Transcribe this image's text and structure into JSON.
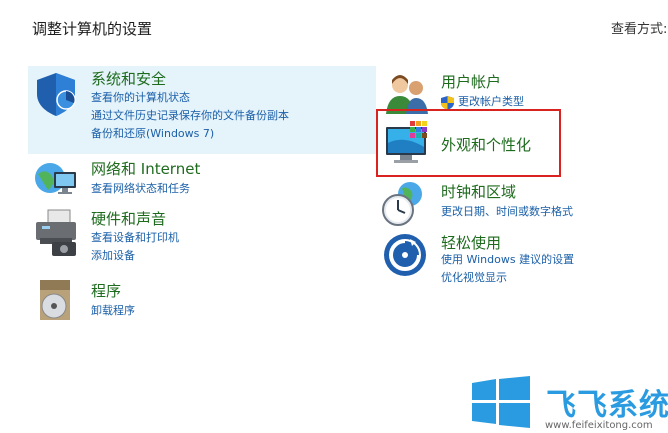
{
  "header": {
    "title": "调整计算机的设置",
    "view_by": "查看方式:"
  },
  "categories": [
    {
      "title": "系统和安全",
      "links": [
        "查看你的计算机状态",
        "通过文件历史记录保存你的文件备份副本",
        "备份和还原(Windows 7)"
      ]
    },
    {
      "title": "网络和 Internet",
      "links": [
        "查看网络状态和任务"
      ]
    },
    {
      "title": "硬件和声音",
      "links": [
        "查看设备和打印机",
        "添加设备"
      ]
    },
    {
      "title": "程序",
      "links": [
        "卸载程序"
      ]
    },
    {
      "title": "用户帐户",
      "links": [
        "更改帐户类型"
      ]
    },
    {
      "title": "外观和个性化",
      "links": []
    },
    {
      "title": "时钟和区域",
      "links": [
        "更改日期、时间或数字格式"
      ]
    },
    {
      "title": "轻松使用",
      "links": [
        "使用 Windows 建议的设置",
        "优化视觉显示"
      ]
    }
  ],
  "watermark": {
    "brand": "飞飞系统",
    "url": "www.feifeixitong.com"
  },
  "colors": {
    "title_green": "#1e6b1e",
    "link_blue": "#1a5fa8",
    "highlight": "#e5f3fb",
    "annotation_red": "#d9231e"
  }
}
